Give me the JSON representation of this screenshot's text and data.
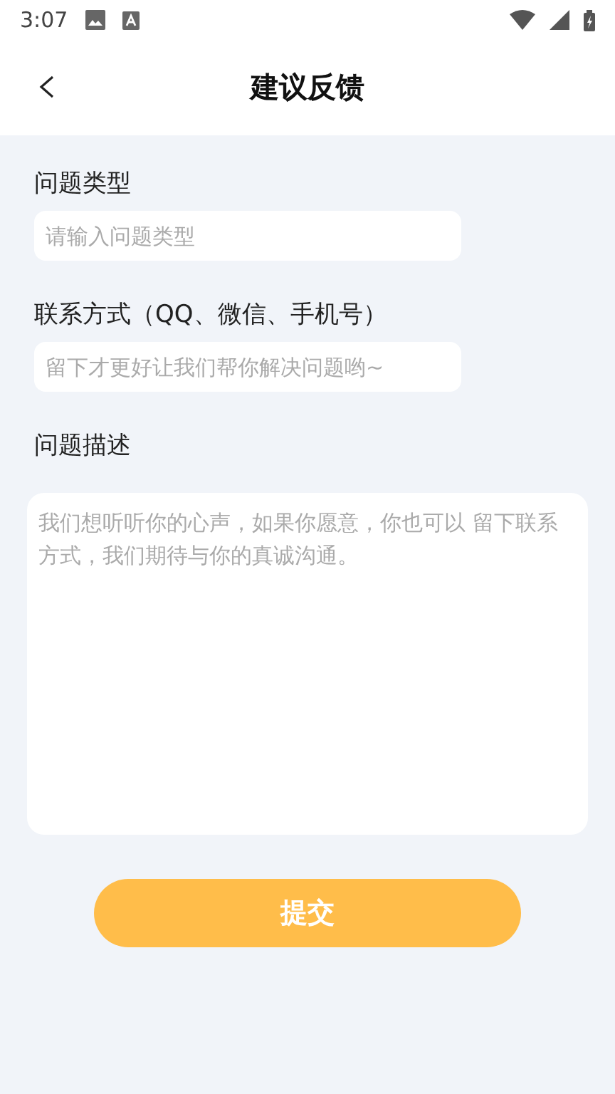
{
  "status_bar": {
    "time": "3:07"
  },
  "header": {
    "title": "建议反馈"
  },
  "form": {
    "fields": [
      {
        "kind": "input",
        "label": "问题类型",
        "placeholder": "请输入问题类型"
      },
      {
        "kind": "input",
        "label": "联系方式（QQ、微信、手机号）",
        "placeholder": "留下才更好让我们帮你解决问题哟~"
      },
      {
        "kind": "textarea",
        "label": "问题描述",
        "placeholder": "我们想听听你的心声，如果你愿意，你也可以 留下联系方式，我们期待与你的真诚沟通。"
      }
    ],
    "submit": "提交"
  }
}
